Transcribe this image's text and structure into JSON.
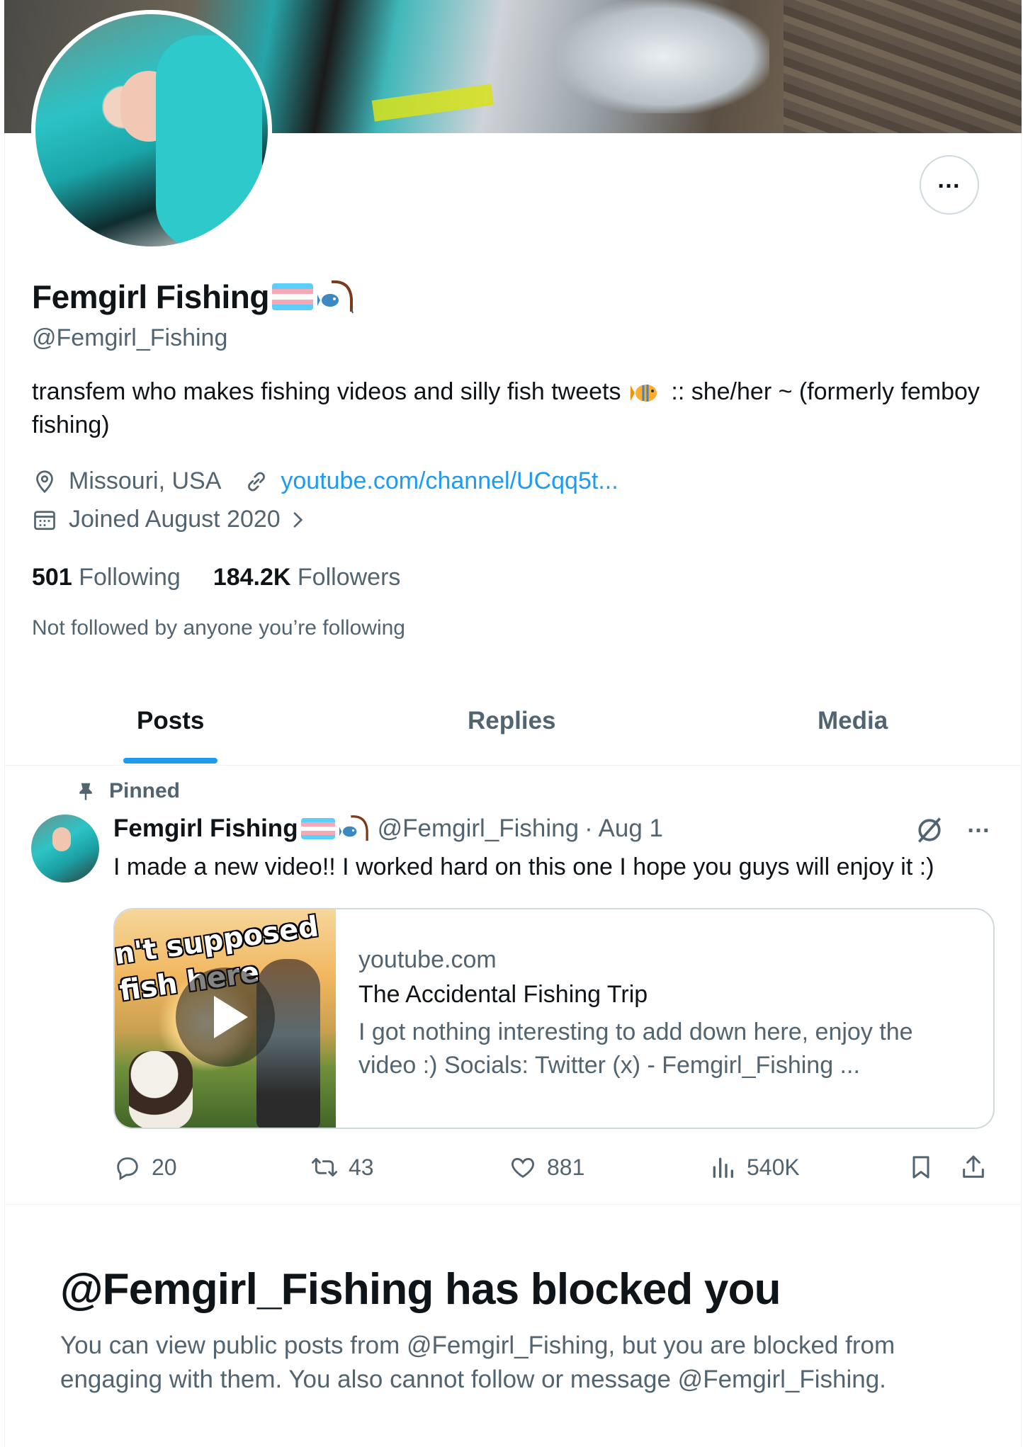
{
  "profile": {
    "display_name": "Femgirl Fishing",
    "handle": "@Femgirl_Fishing",
    "bio_before_emoji": "transfem who makes fishing videos and silly fish tweets",
    "bio_after_emoji": ":: she/her ~ (formerly femboy fishing)",
    "location": "Missouri, USA",
    "website": "youtube.com/channel/UCqq5t...",
    "joined": "Joined August 2020",
    "following_count": "501",
    "following_label": "Following",
    "followers_count": "184.2K",
    "followers_label": "Followers",
    "not_followed_note": "Not followed by anyone you’re following"
  },
  "tabs": [
    {
      "label": "Posts",
      "active": true
    },
    {
      "label": "Replies",
      "active": false
    },
    {
      "label": "Media",
      "active": false
    }
  ],
  "pinned_post": {
    "pinned_label": "Pinned",
    "author_name": "Femgirl Fishing",
    "author_handle": "@Femgirl_Fishing",
    "date": "· Aug 1",
    "text": "I made a new video!! I worked hard on this one I hope you guys will enjoy it :)",
    "card": {
      "thumbnail_caption_line1": "n't supposed",
      "thumbnail_caption_line2": "fish here",
      "domain": "youtube.com",
      "title": "The Accidental Fishing Trip",
      "description": "I got nothing interesting to add down here, enjoy the video :) Socials: Twitter (x) - Femgirl_Fishing ..."
    },
    "stats": {
      "replies": "20",
      "reposts": "43",
      "likes": "881",
      "views": "540K"
    }
  },
  "blocked": {
    "title": "@Femgirl_Fishing has blocked you",
    "description": "You can view public posts from @Femgirl_Fishing, but you are blocked from engaging with them. You also cannot follow or message @Femgirl_Fishing."
  },
  "colors": {
    "accent": "#1d9bf0",
    "text_primary": "#0f1419",
    "text_secondary": "#536471",
    "border": "#cfd9de"
  },
  "icons": [
    "more-icon",
    "location-icon",
    "link-icon",
    "calendar-icon",
    "chevron-right-icon",
    "pin-icon",
    "grok-icon",
    "reply-icon",
    "repost-icon",
    "like-icon",
    "views-icon",
    "bookmark-icon",
    "share-icon",
    "trans-flag-icon",
    "fishing-pole-icon",
    "tropical-fish-icon",
    "play-icon"
  ]
}
